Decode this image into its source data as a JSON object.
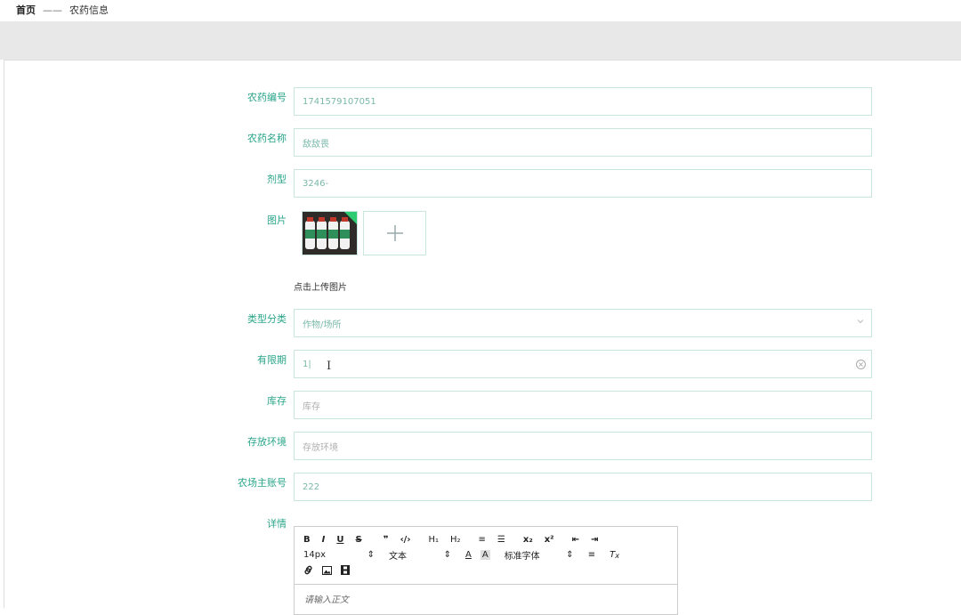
{
  "breadcrumb": {
    "home": "首页",
    "separator": "——",
    "current": "农药信息"
  },
  "form": {
    "code": {
      "label": "农药编号",
      "value": "1741579107051"
    },
    "name": {
      "label": "农药名称",
      "value": "敌敌畏"
    },
    "dosage_form": {
      "label": "剂型",
      "value": "3246-"
    },
    "image": {
      "label": "图片",
      "upload_text": "点击上传图片",
      "plus": "+"
    },
    "category": {
      "label": "类型分类",
      "placeholder": "作物/场所"
    },
    "validity": {
      "label": "有限期",
      "value": "1|"
    },
    "stock": {
      "label": "库存",
      "placeholder": "库存"
    },
    "storage": {
      "label": "存放环境",
      "placeholder": "存放环境"
    },
    "owner_account": {
      "label": "农场主账号",
      "value": "222"
    },
    "details": {
      "label": "详情",
      "toolbar_row1": [
        "B",
        "I",
        "U",
        "S",
        "❞",
        "‹/›",
        "H₁",
        "H₂",
        "≡",
        "☰",
        "x₂",
        "x²",
        "⇤",
        "⇥"
      ],
      "font_size": "14px",
      "text_style": "文本",
      "font_family": "标准字体",
      "placeholder": "请输入正文"
    }
  },
  "colors": {
    "accent": "#2aa58a",
    "border": "#c9e6de"
  }
}
